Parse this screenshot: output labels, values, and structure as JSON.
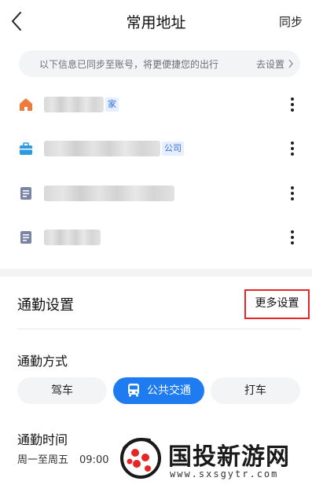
{
  "header": {
    "title": "常用地址",
    "sync_label": "同步"
  },
  "banner": {
    "text": "以下信息已同步至账号，将更便捷您的出行",
    "link": "去设置"
  },
  "addresses": [
    {
      "icon": "home-icon",
      "tag": "家"
    },
    {
      "icon": "briefcase-icon",
      "tag": "公司"
    },
    {
      "icon": "location-doc-icon",
      "tag": ""
    },
    {
      "icon": "location-doc-icon",
      "tag": ""
    }
  ],
  "commute": {
    "title": "通勤设置",
    "more_settings": "更多设置",
    "mode_label": "通勤方式",
    "modes": [
      "驾车",
      "公共交通",
      "打车"
    ],
    "selected_mode": "公共交通",
    "time_label": "通勤时间",
    "days": "周一至周五",
    "time": "09:00"
  },
  "watermark": {
    "title": "国投新游网",
    "url": "www.sxsgytr.com"
  },
  "colors": {
    "accent": "#1e7bf0",
    "highlight_border": "#e52626",
    "home_icon": "#f07a3a",
    "work_icon": "#2a9be0",
    "doc_icon": "#7b84a6"
  }
}
